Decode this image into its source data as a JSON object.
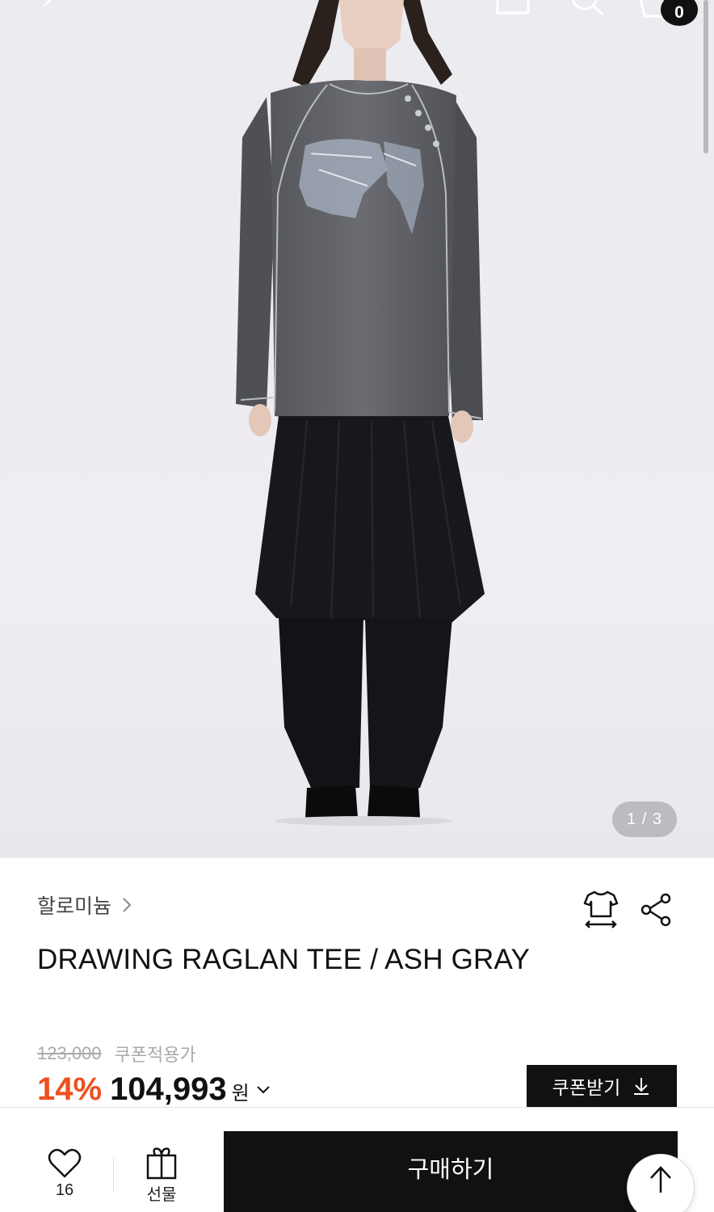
{
  "header": {
    "cart_count": "0"
  },
  "gallery": {
    "pager": "1 / 3",
    "image_alt": "Model wearing gray raglan tee with black pleated skirt and wide pants"
  },
  "product": {
    "brand": "할로미늄",
    "title": "DRAWING RAGLAN TEE / ASH GRAY",
    "original_price": "123,000",
    "coupon_note": "쿠폰적용가",
    "discount_rate": "14%",
    "sale_price": "104,993",
    "currency": "원",
    "coupon_button": "쿠폰받기"
  },
  "bottom_bar": {
    "like_count": "16",
    "gift_label": "선물",
    "buy_label": "구매하기"
  },
  "colors": {
    "accent_discount": "#ee4f1e",
    "primary_button": "#111111"
  },
  "icons": [
    "back-icon",
    "document-icon",
    "search-icon",
    "cart-icon",
    "size-guide-icon",
    "share-icon",
    "chevron-right-icon",
    "chevron-down-icon",
    "download-icon",
    "heart-icon",
    "gift-icon",
    "arrow-up-icon"
  ]
}
